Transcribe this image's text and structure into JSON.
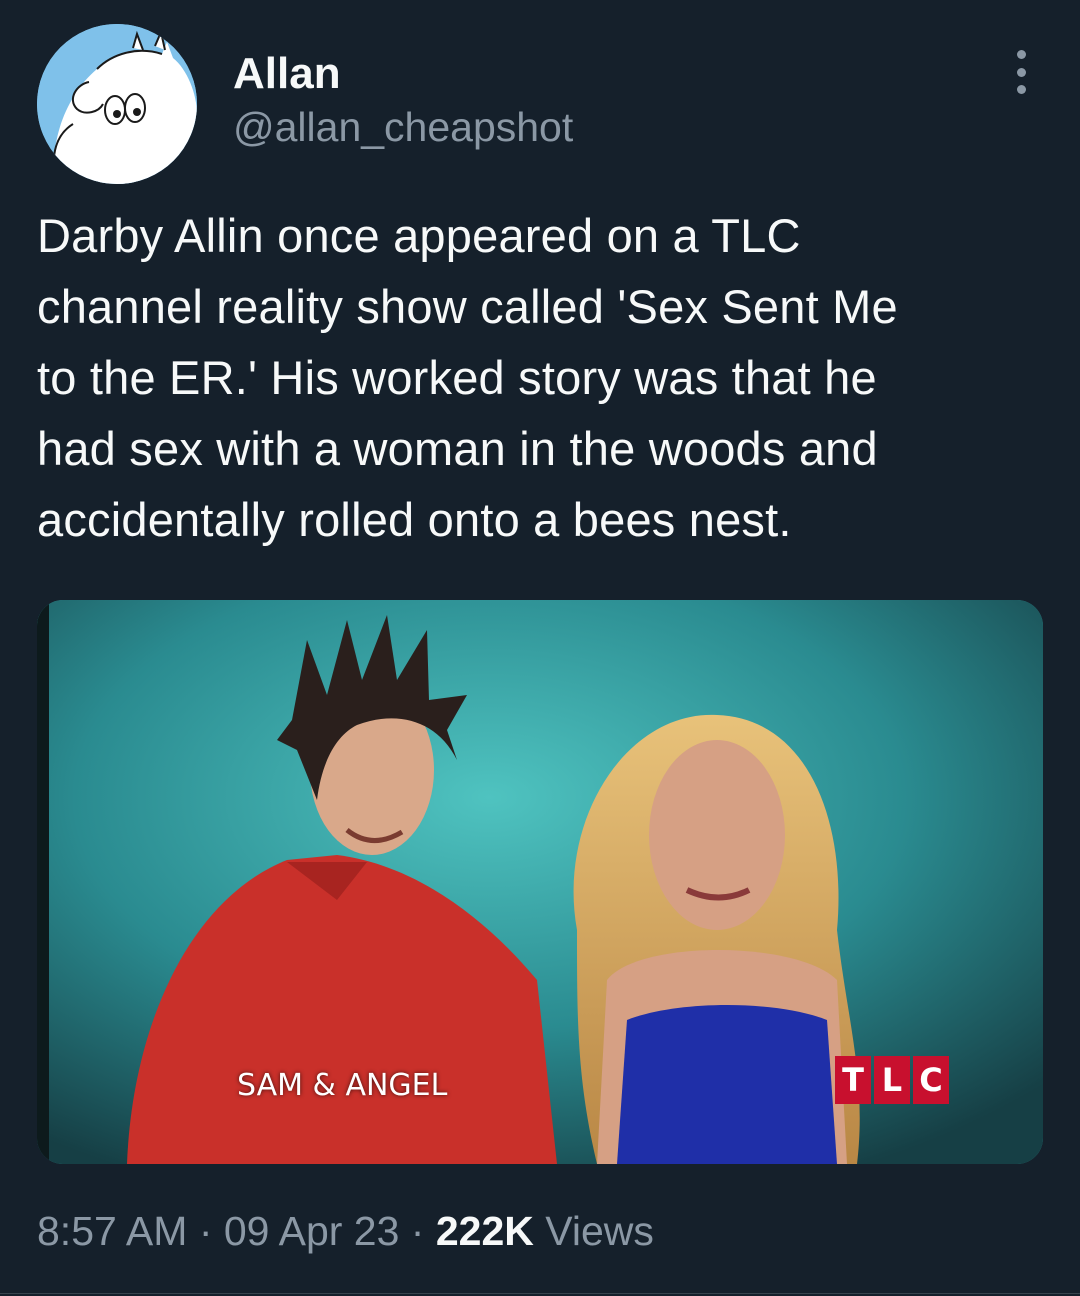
{
  "author": {
    "display_name": "Allan",
    "handle": "@allan_cheapshot",
    "avatar_icon": "moomin-avatar-icon"
  },
  "more_menu_icon": "more-vertical-icon",
  "tweet": {
    "text_lines": [
      "Darby Allin once appeared on a TLC",
      "channel reality show called 'Sex Sent Me",
      "to the ER.' His worked story was that he",
      "had sex with a woman in the woods and",
      "accidentally rolled onto a bees nest."
    ]
  },
  "media": {
    "lower_third": "SAM & ANGEL",
    "network_logo": [
      "T",
      "L",
      "C"
    ]
  },
  "meta": {
    "time": "8:57 AM",
    "sep1": " · ",
    "date": "09 Apr 23",
    "sep2": " · ",
    "views_count": "222K",
    "views_label": " Views"
  },
  "colors": {
    "background": "#15202b",
    "primary_text": "#f7f9f9",
    "secondary_text": "#8b98a5",
    "tlc_red": "#c8102e"
  }
}
